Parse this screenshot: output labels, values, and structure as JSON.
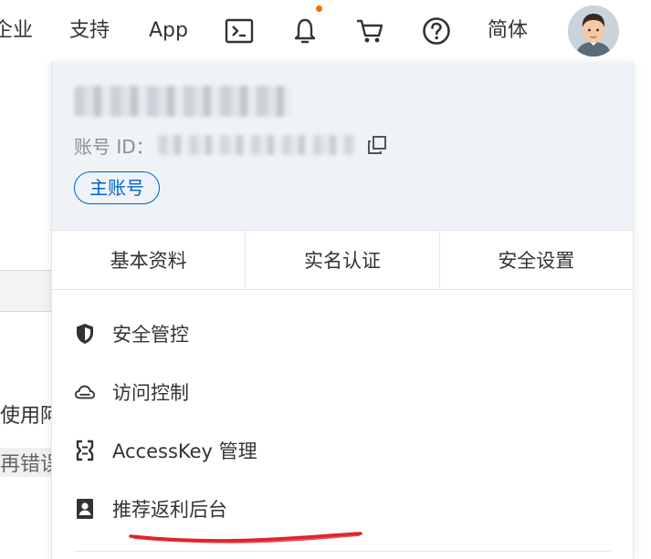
{
  "topbar": {
    "nav_enterprise": "企业",
    "nav_support": "支持",
    "nav_app": "App",
    "language": "简体",
    "icons": [
      "terminal-icon",
      "bell-icon",
      "cart-icon",
      "help-icon"
    ],
    "notification_dot_color": "#ff6a00"
  },
  "background": {
    "text_use": "使用阿",
    "text_retry": "再错误"
  },
  "account": {
    "id_label": "账号 ID：",
    "type_badge": "主账号"
  },
  "tabs": [
    {
      "label": "基本资料"
    },
    {
      "label": "实名认证"
    },
    {
      "label": "安全设置"
    }
  ],
  "menu": [
    {
      "label": "安全管控",
      "icon": "shield-icon"
    },
    {
      "label": "访问控制",
      "icon": "cloud-icon"
    },
    {
      "label": "AccessKey 管理",
      "icon": "accesskey-icon"
    },
    {
      "label": "推荐返利后台",
      "icon": "id-card-icon"
    }
  ],
  "colors": {
    "accent": "#0064c8",
    "header_bg": "#eff3f8",
    "annotation": "#e0242c"
  }
}
